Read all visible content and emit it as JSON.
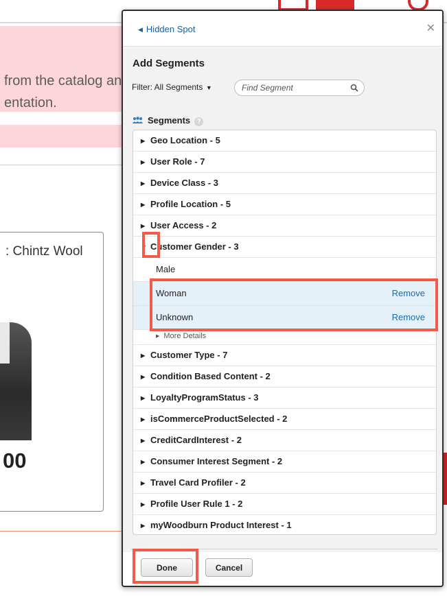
{
  "background": {
    "alert_text_line1": "from the catalog and",
    "alert_text_line2": "entation.",
    "product_title": ": Chintz Wool",
    "product_price": "00"
  },
  "dialog": {
    "back_label": "Hidden Spot",
    "title": "Add Segments",
    "filter_label": "Filter: All Segments",
    "search_placeholder": "Find Segment",
    "segments_header": "Segments",
    "help_symbol": "?",
    "segments": [
      {
        "label": "Geo Location - 5",
        "expanded": false
      },
      {
        "label": "User Role - 7",
        "expanded": false
      },
      {
        "label": "Device Class - 3",
        "expanded": false
      },
      {
        "label": "Profile Location - 5",
        "expanded": false
      },
      {
        "label": "User Access - 2",
        "expanded": false
      },
      {
        "label": "Customer Gender - 3",
        "expanded": true
      },
      {
        "label": "Customer Type - 7",
        "expanded": false
      },
      {
        "label": "Condition Based Content - 2",
        "expanded": false
      },
      {
        "label": "LoyaltyProgramStatus - 3",
        "expanded": false
      },
      {
        "label": "isCommerceProductSelected - 2",
        "expanded": false
      },
      {
        "label": "CreditCardInterest - 2",
        "expanded": false
      },
      {
        "label": "Consumer Interest Segment - 2",
        "expanded": false
      },
      {
        "label": "Travel Card Profiler - 2",
        "expanded": false
      },
      {
        "label": "Profile User Rule 1 - 2",
        "expanded": false
      },
      {
        "label": "myWoodburn Product Interest - 1",
        "expanded": false
      }
    ],
    "gender_options": [
      {
        "label": "Male",
        "selected": false
      },
      {
        "label": "Woman",
        "selected": true,
        "action": "Remove"
      },
      {
        "label": "Unknown",
        "selected": true,
        "action": "Remove"
      }
    ],
    "more_details": "More Details",
    "done_label": "Done",
    "cancel_label": "Cancel"
  },
  "colors": {
    "link": "#1a5e9e",
    "highlight": "#f25a4a",
    "selected_row": "#e5f1f8",
    "alert_bg": "#fdd6db"
  }
}
